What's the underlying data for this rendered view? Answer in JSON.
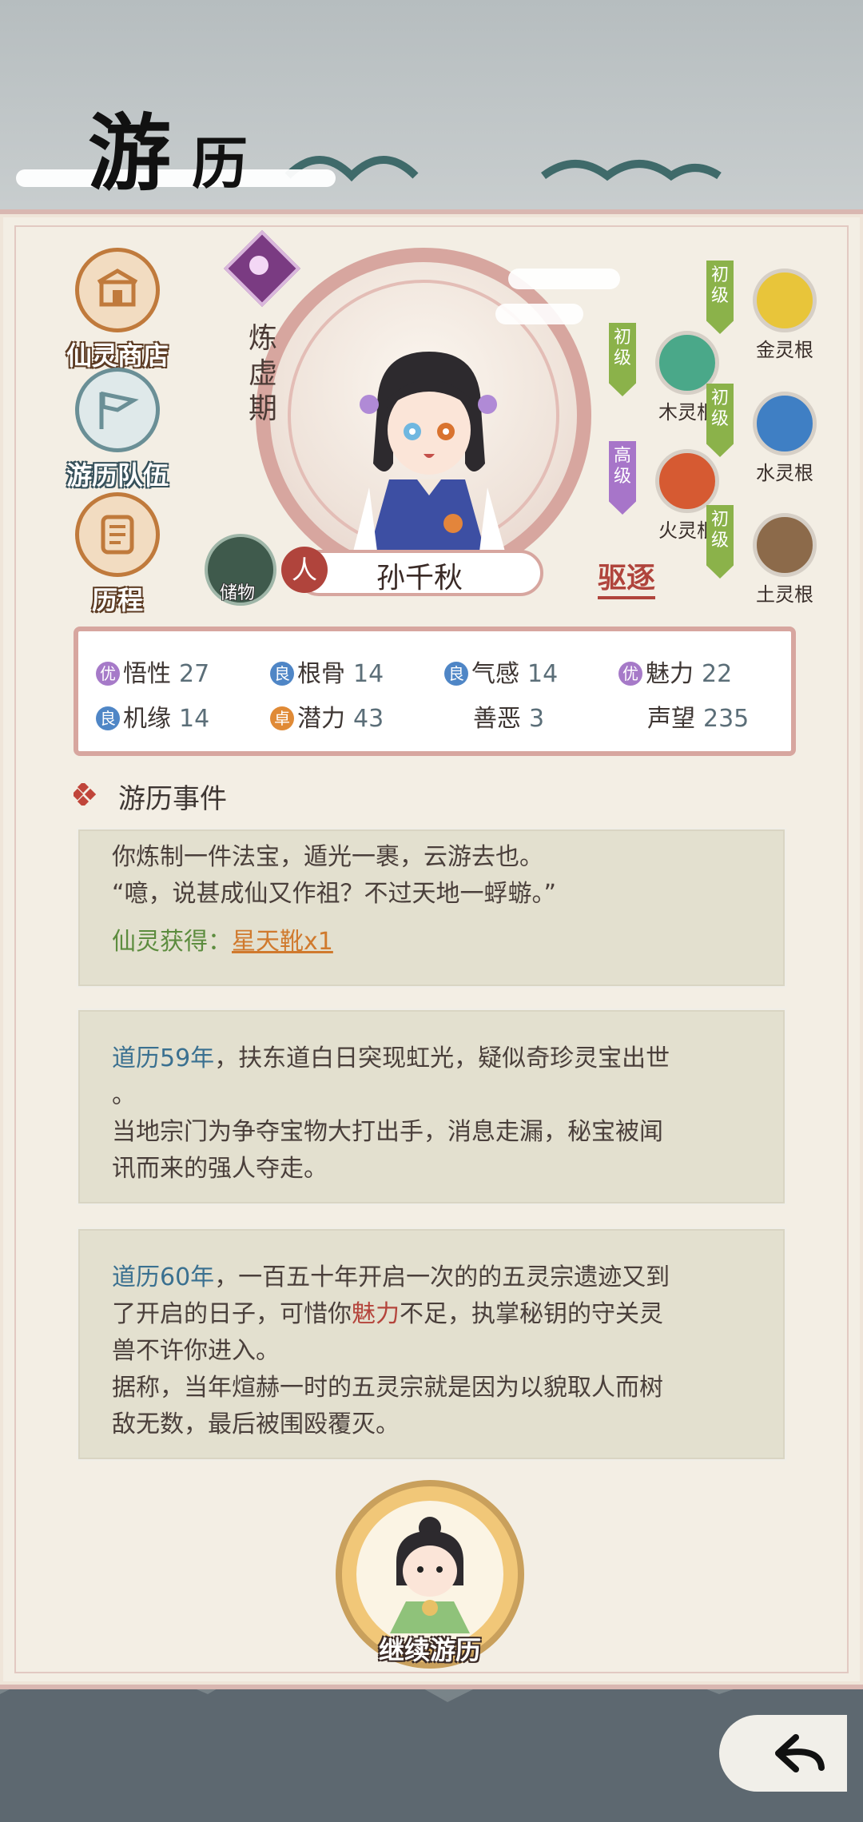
{
  "title": {
    "char1": "游",
    "char2": "历"
  },
  "menu": [
    {
      "label": "仙灵商店"
    },
    {
      "label": "游历队伍"
    },
    {
      "label": "历程"
    }
  ],
  "character": {
    "realm": "炼虚期",
    "name": "孙千秋",
    "type_tag": "人",
    "expel_label": "驱逐",
    "item_label": "储物"
  },
  "spirit_roots": [
    {
      "label": "金灵根",
      "grade": "初级",
      "color": "#e8c53a",
      "grade_color": "#8bb24a"
    },
    {
      "label": "木灵根",
      "grade": "初级",
      "color": "#4aa889",
      "grade_color": "#8bb24a"
    },
    {
      "label": "水灵根",
      "grade": "初级",
      "color": "#3f7fc4",
      "grade_color": "#8bb24a"
    },
    {
      "label": "火灵根",
      "grade": "高级",
      "color": "#d65a32",
      "grade_color": "#a775c9"
    },
    {
      "label": "土灵根",
      "grade": "初级",
      "color": "#8c6a4a",
      "grade_color": "#8bb24a"
    }
  ],
  "attributes": [
    {
      "badge": "优",
      "badge_color": "#a67ac8",
      "name": "悟性",
      "value": "27"
    },
    {
      "badge": "良",
      "badge_color": "#4f86c6",
      "name": "根骨",
      "value": "14"
    },
    {
      "badge": "良",
      "badge_color": "#4f86c6",
      "name": "气感",
      "value": "14"
    },
    {
      "badge": "优",
      "badge_color": "#a67ac8",
      "name": "魅力",
      "value": "22"
    },
    {
      "badge": "良",
      "badge_color": "#4f86c6",
      "name": "机缘",
      "value": "14"
    },
    {
      "badge": "卓",
      "badge_color": "#e08a36",
      "name": "潜力",
      "value": "43"
    },
    {
      "badge": "",
      "badge_color": "",
      "name": "善恶",
      "value": "3"
    },
    {
      "badge": "",
      "badge_color": "",
      "name": "声望",
      "value": "235"
    }
  ],
  "events_title": "游历事件",
  "events": {
    "e1": {
      "line1": "你炼制一件法宝，遁光一裹，云游去也。",
      "line2": "“噫，说甚成仙又作祖？不过天地一蜉蝣。”",
      "reward_label": "仙灵获得：",
      "reward_item": "星天靴x1"
    },
    "e2": {
      "year": "道历59年",
      "line1_rest": "，扶东道白日突现虹光，疑似奇珍灵宝出世",
      "line2": "。",
      "line3": "当地宗门为争夺宝物大打出手，消息走漏，秘宝被闻",
      "line4": "讯而来的强人夺走。"
    },
    "e3": {
      "year": "道历60年",
      "line1_rest": "，一百五十年开启一次的的五灵宗遗迹又到",
      "line2_a": "了开启的日子，可惜你",
      "line2_hl": "魅力",
      "line2_b": "不足，执掌秘钥的守关灵",
      "line3": "兽不许你进入。",
      "line4": "据称，当年煊赫一时的五灵宗就是因为以貌取人而树",
      "line5": "敌无数，最后被围殴覆灭。"
    }
  },
  "continue_label": "继续游历"
}
